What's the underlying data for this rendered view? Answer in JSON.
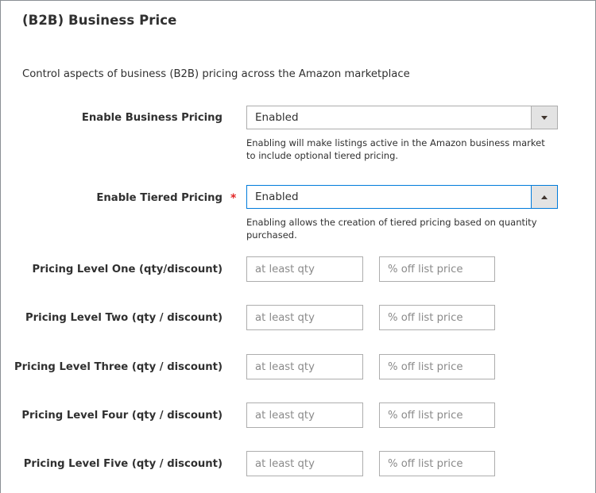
{
  "section": {
    "title": "(B2B) Business Price",
    "description": "Control aspects of business (B2B) pricing across the Amazon marketplace"
  },
  "fields": {
    "enable_business_pricing": {
      "label": "Enable Business Pricing",
      "value": "Enabled",
      "required": false,
      "note": "Enabling will make listings active in the Amazon business market to include optional tiered pricing.",
      "dropdown_icon": "arrow-down-icon"
    },
    "enable_tiered_pricing": {
      "label": "Enable Tiered Pricing",
      "value": "Enabled",
      "required": true,
      "required_mark": "*",
      "note": "Enabling allows the creation of tiered pricing based on quantity purchased.",
      "dropdown_icon": "arrow-up-icon"
    }
  },
  "pricing_levels": [
    {
      "label": "Pricing Level One (qty/discount)",
      "qty_value": "",
      "qty_placeholder": "at least qty",
      "discount_value": "",
      "discount_placeholder": "% off list price"
    },
    {
      "label": "Pricing Level Two (qty / discount)",
      "qty_value": "",
      "qty_placeholder": "at least qty",
      "discount_value": "",
      "discount_placeholder": "% off list price"
    },
    {
      "label": "Pricing Level Three (qty / discount)",
      "qty_value": "",
      "qty_placeholder": "at least qty",
      "discount_value": "",
      "discount_placeholder": "% off list price"
    },
    {
      "label": "Pricing Level Four (qty / discount)",
      "qty_value": "",
      "qty_placeholder": "at least qty",
      "discount_value": "",
      "discount_placeholder": "% off list price"
    },
    {
      "label": "Pricing Level Five (qty / discount)",
      "qty_value": "",
      "qty_placeholder": "at least qty",
      "discount_value": "",
      "discount_placeholder": "% off list price"
    }
  ],
  "colors": {
    "focus_border": "#007bdb",
    "required_star": "#e22626",
    "text": "#303030",
    "border": "#adadad"
  }
}
